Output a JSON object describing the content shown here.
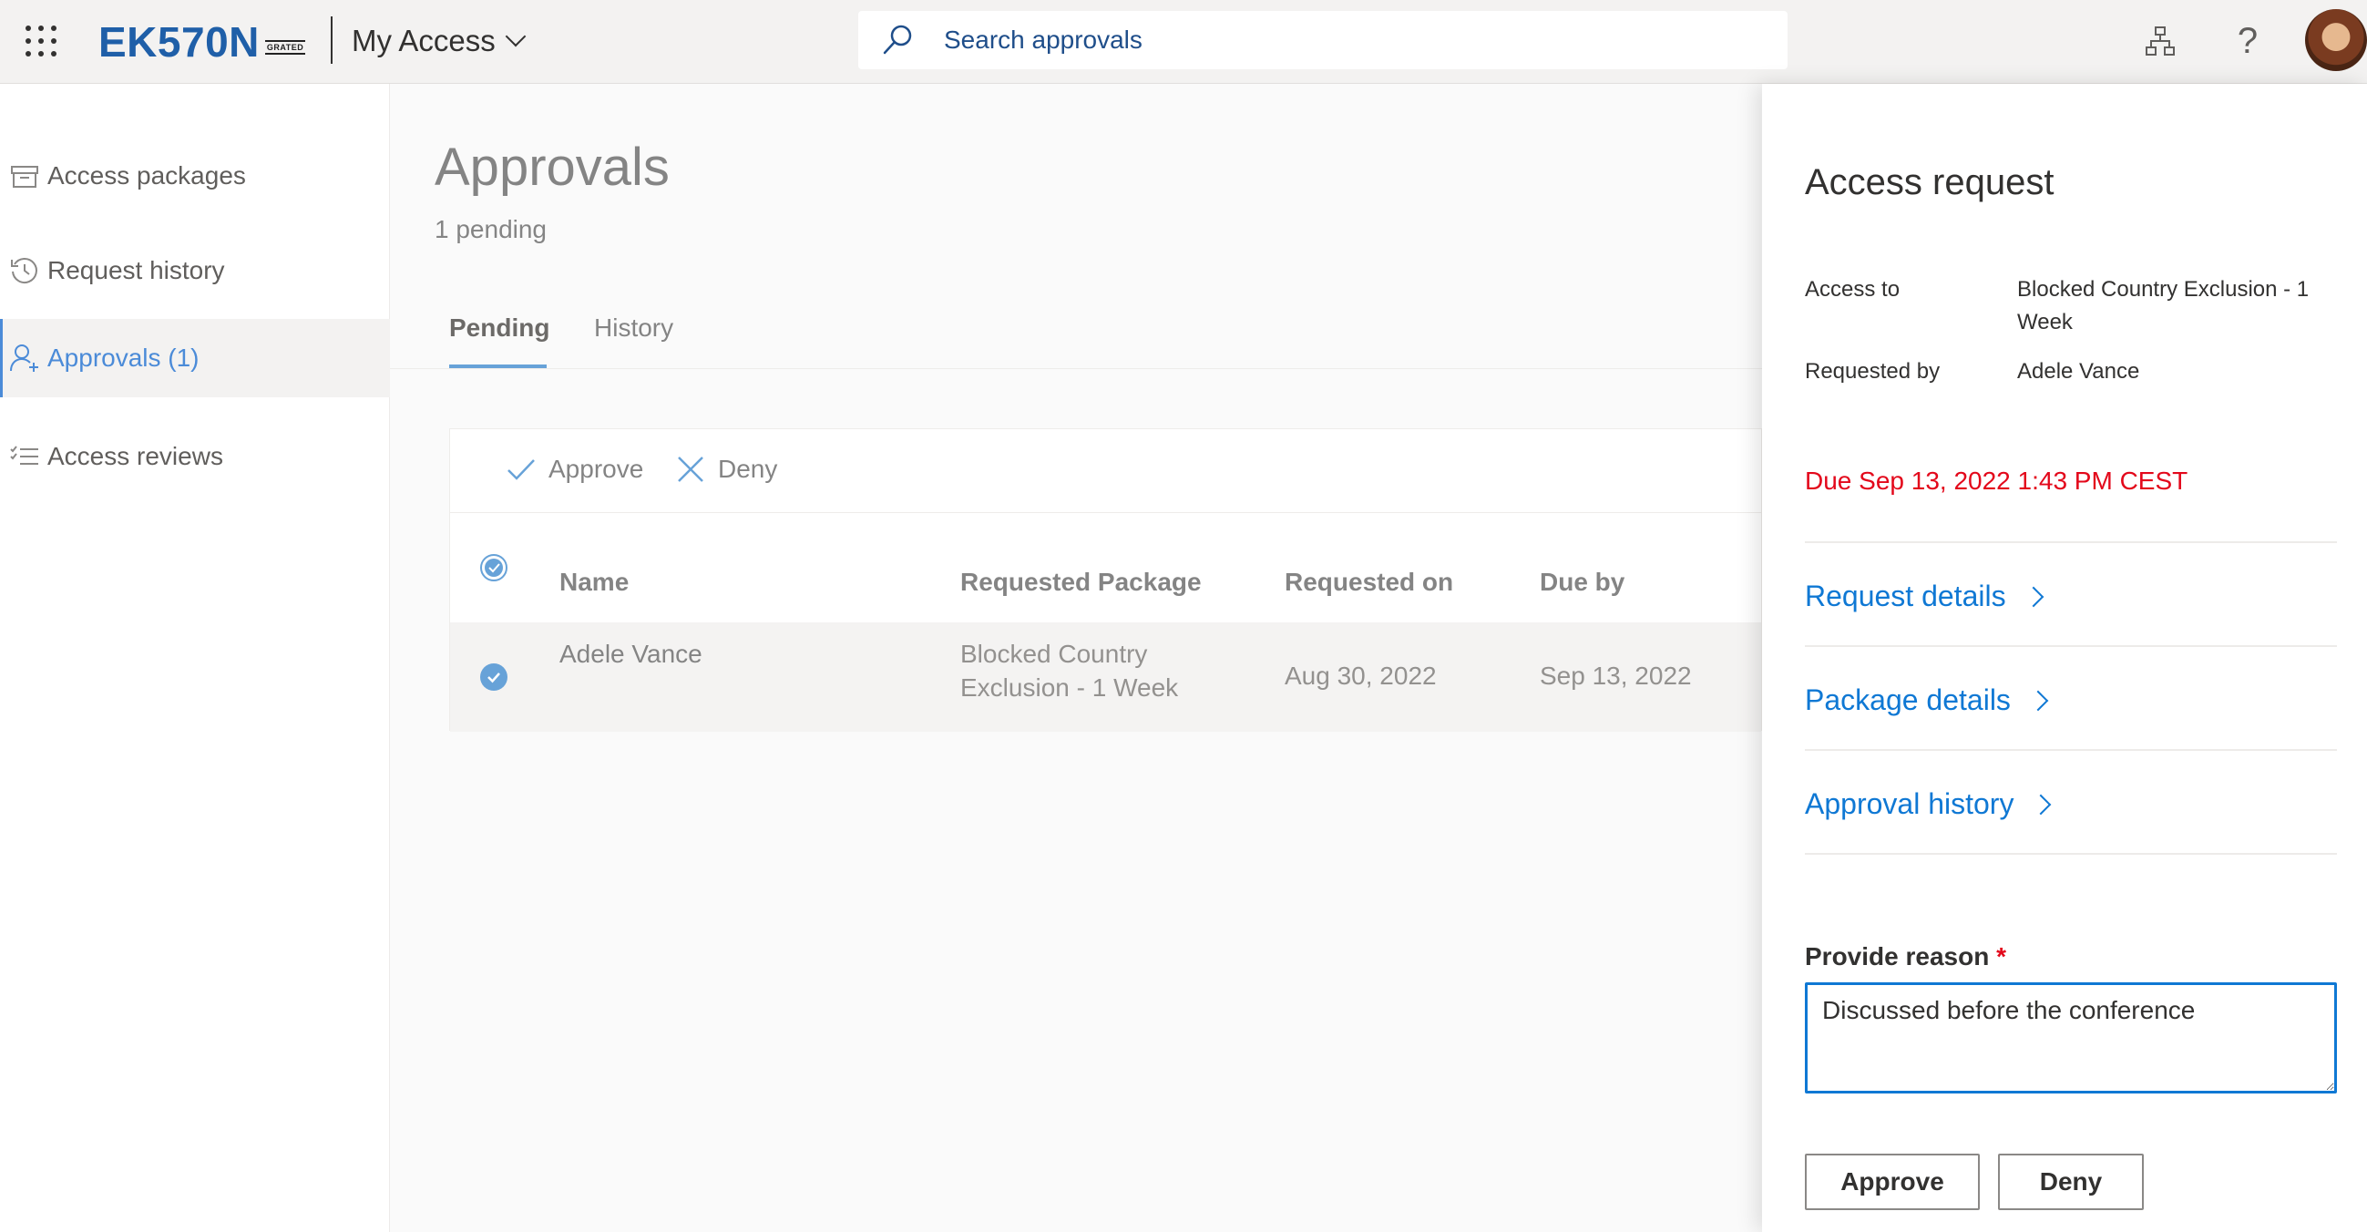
{
  "header": {
    "logo_main": "EK570N",
    "logo_sub": "GRATED",
    "app_title": "My Access",
    "search_placeholder": "Search approvals",
    "icons": [
      "waffle-icon",
      "org-chart-icon",
      "help-icon"
    ]
  },
  "sidebar": {
    "items": [
      {
        "label": "Access packages",
        "icon": "package-icon"
      },
      {
        "label": "Request history",
        "icon": "history-icon"
      },
      {
        "label": "Approvals (1)",
        "icon": "approver-icon",
        "active": true
      },
      {
        "label": "Access reviews",
        "icon": "checklist-icon"
      }
    ]
  },
  "main": {
    "title": "Approvals",
    "subtitle": "1 pending",
    "tabs": [
      {
        "label": "Pending",
        "active": true
      },
      {
        "label": "History",
        "active": false
      }
    ],
    "commands": {
      "approve": "Approve",
      "deny": "Deny"
    },
    "table": {
      "columns": [
        "Name",
        "Requested Package",
        "Requested on",
        "Due by"
      ],
      "rows": [
        {
          "name": "Adele Vance",
          "package_line1": "Blocked Country",
          "package_line2": "Exclusion - 1 Week",
          "requested_on": "Aug 30, 2022",
          "due_by": "Sep 13, 2022",
          "selected": true
        }
      ]
    }
  },
  "panel": {
    "title": "Access request",
    "access_to_label": "Access to",
    "access_to_value": "Blocked Country Exclusion - 1 Week",
    "requested_by_label": "Requested by",
    "requested_by_value": "Adele Vance",
    "due": "Due Sep 13, 2022 1:43 PM CEST",
    "links": [
      "Request details",
      "Package details",
      "Approval history"
    ],
    "reason_label": "Provide reason",
    "reason_required": "*",
    "reason_value": "Discussed before the conference",
    "approve_label": "Approve",
    "deny_label": "Deny"
  },
  "colors": {
    "accent": "#0f78d4",
    "nav_active": "#4b8bd8",
    "due_red": "#e3081b",
    "logo_blue": "#1f5fa8"
  }
}
